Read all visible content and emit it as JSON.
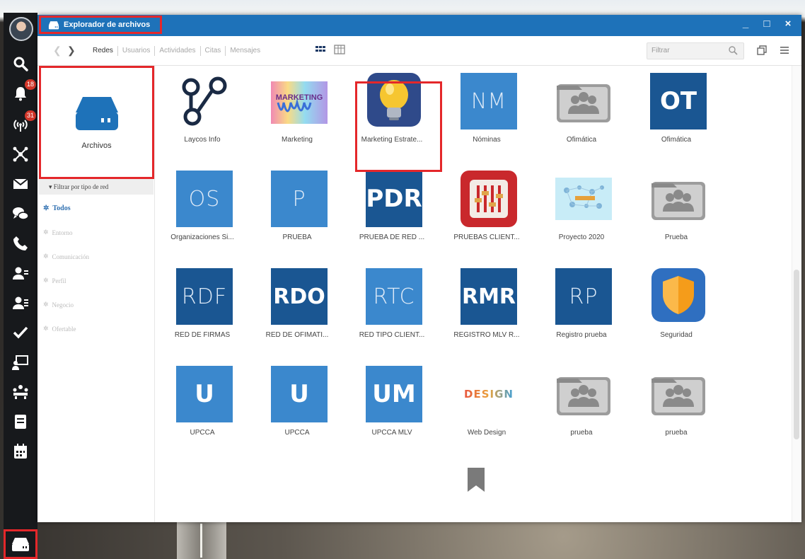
{
  "dock": {
    "items": [
      {
        "icon": "search-icon"
      },
      {
        "icon": "bell-icon",
        "badge": "18"
      },
      {
        "icon": "antenna-icon",
        "badge": "31"
      },
      {
        "icon": "network-icon"
      },
      {
        "icon": "mail-icon"
      },
      {
        "icon": "chat-icon"
      },
      {
        "icon": "phone-icon"
      },
      {
        "icon": "user-contacts-icon"
      },
      {
        "icon": "user-groups-icon"
      },
      {
        "icon": "check-icon"
      },
      {
        "icon": "presentation-icon"
      },
      {
        "icon": "meeting-icon"
      },
      {
        "icon": "notebook-icon"
      },
      {
        "icon": "calendar-icon"
      },
      {
        "icon": "drive-icon"
      }
    ]
  },
  "window": {
    "title": "Explorador de archivos",
    "controls": {
      "minimize": "_",
      "maximize": "□",
      "close": "×"
    }
  },
  "toolbar": {
    "tabs": [
      "Redes",
      "Usuarios",
      "Actividades",
      "Citas",
      "Mensajes"
    ],
    "active_tab": "Redes",
    "filter_placeholder": "Filtrar"
  },
  "sidebar": {
    "card_label": "Archivos",
    "filter_heading": "▾ Filtrar por tipo de red",
    "filter_types": [
      "Todos",
      "Entorno",
      "Comunicación",
      "Perfil",
      "Negocio",
      "Ofertable"
    ],
    "active_filter": "Todos"
  },
  "grid": {
    "items": [
      {
        "label": "Laycos Info",
        "icon": "share-network-icon",
        "style": "none"
      },
      {
        "label": "Marketing",
        "icon": "marketing-image-icon",
        "style": "image"
      },
      {
        "label": "Marketing Estrate...",
        "icon": "lightbulb-icon",
        "style": "app",
        "selected": true
      },
      {
        "label": "Nóminas",
        "abbr": "NM",
        "style": "light-thin"
      },
      {
        "label": "Ofimática",
        "icon": "folder-people-icon",
        "style": "folder"
      },
      {
        "label": "Ofimática",
        "abbr": "OT",
        "style": "dark-bold"
      },
      {
        "label": "Organizaciones Si...",
        "abbr": "OS",
        "style": "light-thin"
      },
      {
        "label": "PRUEBA",
        "abbr": "P",
        "style": "light-thin"
      },
      {
        "label": "PRUEBA DE RED ...",
        "abbr": "PDR",
        "style": "dark-bold"
      },
      {
        "label": "PRUEBAS CLIENT...",
        "icon": "sliders-icon",
        "style": "red-app"
      },
      {
        "label": "Proyecto 2020",
        "icon": "project-image-icon",
        "style": "image-light"
      },
      {
        "label": "Prueba",
        "icon": "folder-people-icon",
        "style": "folder"
      },
      {
        "label": "RED DE FIRMAS",
        "abbr": "RDF",
        "style": "dark-thin"
      },
      {
        "label": "RED DE OFIMATI...",
        "abbr": "RDO",
        "style": "dark-bold"
      },
      {
        "label": "RED TIPO CLIENT...",
        "abbr": "RTC",
        "style": "light-thin"
      },
      {
        "label": "REGISTRO MLV R...",
        "abbr": "RMR",
        "style": "dark-bold"
      },
      {
        "label": "Registro prueba",
        "abbr": "RP",
        "style": "dark-thin"
      },
      {
        "label": "Seguridad",
        "icon": "shield-icon",
        "style": "app"
      },
      {
        "label": "UPCCA",
        "abbr": "U",
        "style": "light-bold"
      },
      {
        "label": "UPCCA",
        "abbr": "U",
        "style": "light-bold"
      },
      {
        "label": "UPCCA MLV",
        "abbr": "UM",
        "style": "light-bold"
      },
      {
        "label": "Web Design",
        "icon": "design-text-icon",
        "style": "design",
        "text": "DESIGN"
      },
      {
        "label": "prueba",
        "icon": "folder-people-icon",
        "style": "folder"
      },
      {
        "label": "prueba",
        "icon": "folder-people-icon",
        "style": "folder"
      }
    ]
  },
  "colors": {
    "titlebar": "#1e72b9",
    "highlight": "#e4272a",
    "tile_light": "#3b88cd",
    "tile_dark": "#1a5692",
    "dock": "#17191c"
  }
}
